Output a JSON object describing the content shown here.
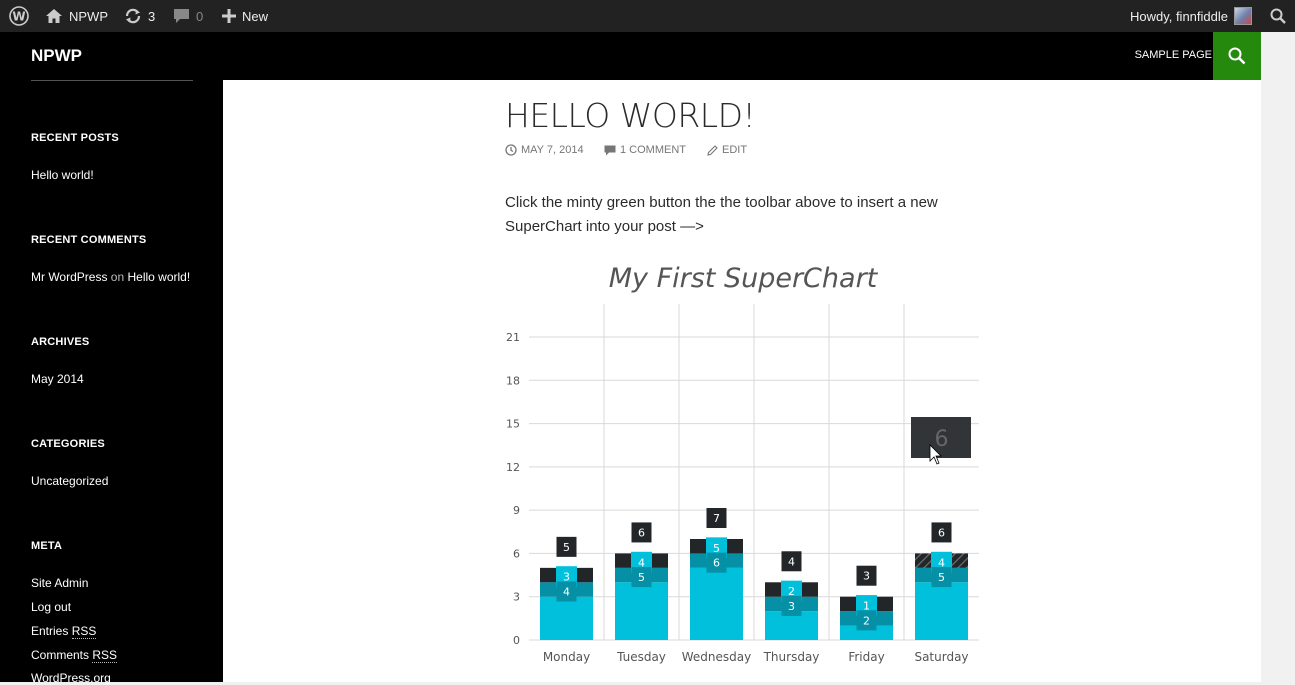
{
  "adminbar": {
    "site_name": "NPWP",
    "updates_count": "3",
    "comments_count": "0",
    "new_label": "New",
    "howdy": "Howdy, finnfiddle"
  },
  "site": {
    "title": "NPWP"
  },
  "nav": {
    "sample_page": "SAMPLE PAGE"
  },
  "sidebar": {
    "recent_posts_title": "RECENT POSTS",
    "recent_posts": [
      "Hello world!"
    ],
    "recent_comments_title": "RECENT COMMENTS",
    "recent_comment": {
      "author": "Mr WordPress",
      "on": "on",
      "post": "Hello world!"
    },
    "archives_title": "ARCHIVES",
    "archives": [
      "May 2014"
    ],
    "categories_title": "CATEGORIES",
    "categories": [
      "Uncategorized"
    ],
    "meta_title": "META",
    "meta": {
      "site_admin": "Site Admin",
      "log_out": "Log out",
      "entries": "Entries",
      "comments": "Comments",
      "rss": "RSS",
      "wordpress_org": "WordPress.org"
    }
  },
  "post": {
    "title": "HELLO WORLD!",
    "date": "MAY 7, 2014",
    "comments": "1 COMMENT",
    "edit": "EDIT",
    "body_line1": "Click the minty green button the the toolbar above to insert a new",
    "body_line2": "SuperChart into your post —>"
  },
  "colors": {
    "accent": "#24890d",
    "series1": "#00c0dc",
    "series2": "#0590a6",
    "series3": "#222628"
  },
  "chart_data": {
    "type": "bar",
    "title": "My First SuperChart",
    "stacked": true,
    "categories": [
      "Monday",
      "Tuesday",
      "Wednesday",
      "Thursday",
      "Friday",
      "Saturday"
    ],
    "series": [
      {
        "values": [
          3,
          4,
          5,
          2,
          1,
          4
        ]
      },
      {
        "values": [
          4,
          5,
          6,
          3,
          2,
          5
        ]
      },
      {
        "values": [
          5,
          6,
          7,
          4,
          3,
          6
        ]
      }
    ],
    "ylim": [
      0,
      21
    ],
    "yticks": [
      0,
      3,
      6,
      9,
      12,
      15,
      18,
      21
    ],
    "grid": true,
    "tooltip": {
      "category": "Saturday",
      "value": "6"
    }
  }
}
